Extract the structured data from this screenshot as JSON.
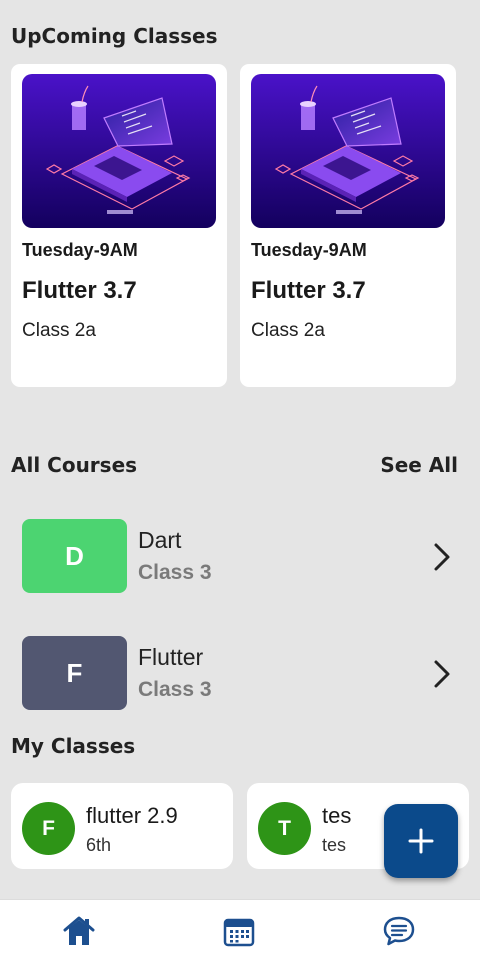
{
  "upcoming": {
    "title": "UpComing Classes",
    "cards": [
      {
        "time": "Tuesday-9AM",
        "title": "Flutter 3.7",
        "subtitle": "Class 2a"
      },
      {
        "time": "Tuesday-9AM",
        "title": "Flutter 3.7",
        "subtitle": "Class 2a"
      }
    ]
  },
  "courses": {
    "title": "All Courses",
    "see_all": "See All",
    "items": [
      {
        "initial": "D",
        "name": "Dart",
        "class": "Class 3",
        "color": "#4cd471"
      },
      {
        "initial": "F",
        "name": "Flutter",
        "class": "Class 3",
        "color": "#525771"
      }
    ]
  },
  "my_classes": {
    "title": "My Classes",
    "items": [
      {
        "initial": "F",
        "name": "flutter 2.9",
        "sub": "6th"
      },
      {
        "initial": "T",
        "name": "tes",
        "sub": "tes"
      }
    ]
  },
  "nav": {
    "items": [
      "home-icon",
      "calendar-icon",
      "chat-icon"
    ],
    "accent": "#1d4f8f"
  }
}
